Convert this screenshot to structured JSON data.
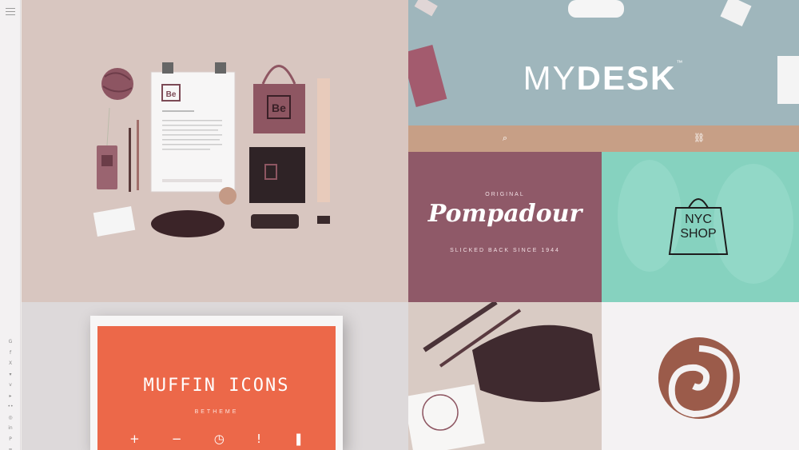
{
  "sidebar": {
    "menu_icon": "hamburger-icon",
    "social": [
      "gplus",
      "f",
      "X",
      "twitter",
      "vimeo",
      "youtube",
      "flickr",
      "pinterest",
      "in",
      "instagram",
      "rss"
    ]
  },
  "tiles": {
    "mydesk": {
      "thin": "MY",
      "bold": "DESK",
      "tm": "™"
    },
    "pompadour": {
      "top": "ORIGINAL",
      "main": "Pompadour",
      "bottom": "SLICKED BACK SINCE 1944"
    },
    "nyc": {
      "line1": "NYC",
      "line2": "SHOP"
    },
    "muffin": {
      "title": "MUFFIN ICONS",
      "subtitle": "BETHEME",
      "icons": [
        "+",
        "−",
        "◷",
        "!",
        "❚"
      ]
    }
  },
  "colors": {
    "stationery_bg": "#d8c6c0",
    "mydesk_bg": "#9fb6bc",
    "pompadour_bg": "#8f5968",
    "nyc_bg": "#86d2bf",
    "poster_orange": "#ec6849"
  }
}
